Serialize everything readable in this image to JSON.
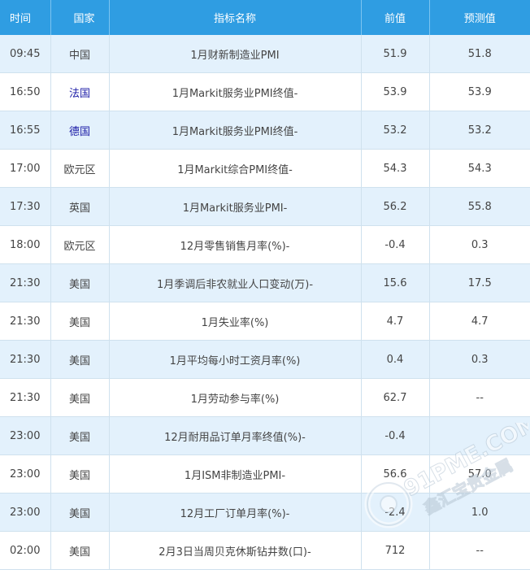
{
  "table": {
    "headers": {
      "time": "时间",
      "country": "国家",
      "name": "指标名称",
      "previous": "前值",
      "forecast": "预测值"
    },
    "rows": [
      {
        "time": "09:45",
        "country": "中国",
        "name": "1月财新制造业PMI",
        "previous": "51.9",
        "forecast": "51.8",
        "country_link": false
      },
      {
        "time": "16:50",
        "country": "法国",
        "name": "1月Markit服务业PMI终值-",
        "previous": "53.9",
        "forecast": "53.9",
        "country_link": true
      },
      {
        "time": "16:55",
        "country": "德国",
        "name": "1月Markit服务业PMI终值-",
        "previous": "53.2",
        "forecast": "53.2",
        "country_link": true
      },
      {
        "time": "17:00",
        "country": "欧元区",
        "name": "1月Markit综合PMI终值-",
        "previous": "54.3",
        "forecast": "54.3",
        "country_link": false
      },
      {
        "time": "17:30",
        "country": "英国",
        "name": "1月Markit服务业PMI-",
        "previous": "56.2",
        "forecast": "55.8",
        "country_link": false
      },
      {
        "time": "18:00",
        "country": "欧元区",
        "name": "12月零售销售月率(%)-",
        "previous": "-0.4",
        "forecast": "0.3",
        "country_link": false
      },
      {
        "time": "21:30",
        "country": "美国",
        "name": "1月季调后非农就业人口变动(万)-",
        "previous": "15.6",
        "forecast": "17.5",
        "country_link": false
      },
      {
        "time": "21:30",
        "country": "美国",
        "name": "1月失业率(%)",
        "previous": "4.7",
        "forecast": "4.7",
        "country_link": false
      },
      {
        "time": "21:30",
        "country": "美国",
        "name": "1月平均每小时工资月率(%)",
        "previous": "0.4",
        "forecast": "0.3",
        "country_link": false
      },
      {
        "time": "21:30",
        "country": "美国",
        "name": "1月劳动参与率(%)",
        "previous": "62.7",
        "forecast": "--",
        "country_link": false
      },
      {
        "time": "23:00",
        "country": "美国",
        "name": "12月耐用品订单月率终值(%)-",
        "previous": "-0.4",
        "forecast": "",
        "country_link": false
      },
      {
        "time": "23:00",
        "country": "美国",
        "name": "1月ISM非制造业PMI-",
        "previous": "56.6",
        "forecast": "57.0",
        "country_link": false
      },
      {
        "time": "23:00",
        "country": "美国",
        "name": "12月工厂订单月率(%)-",
        "previous": "-2.4",
        "forecast": "1.0",
        "country_link": false
      },
      {
        "time": "02:00",
        "country": "美国",
        "name": "2月3日当周贝克休斯钻井数(口)-",
        "previous": "712",
        "forecast": "--",
        "country_link": false
      }
    ]
  },
  "watermark": {
    "line1": "91PME.COM",
    "line2": "鑫汇宝贵金属"
  },
  "colors": {
    "header_bg": "#2f9de2",
    "alt_row_bg": "#e3f1fc",
    "link_text": "#1a1aa6"
  }
}
